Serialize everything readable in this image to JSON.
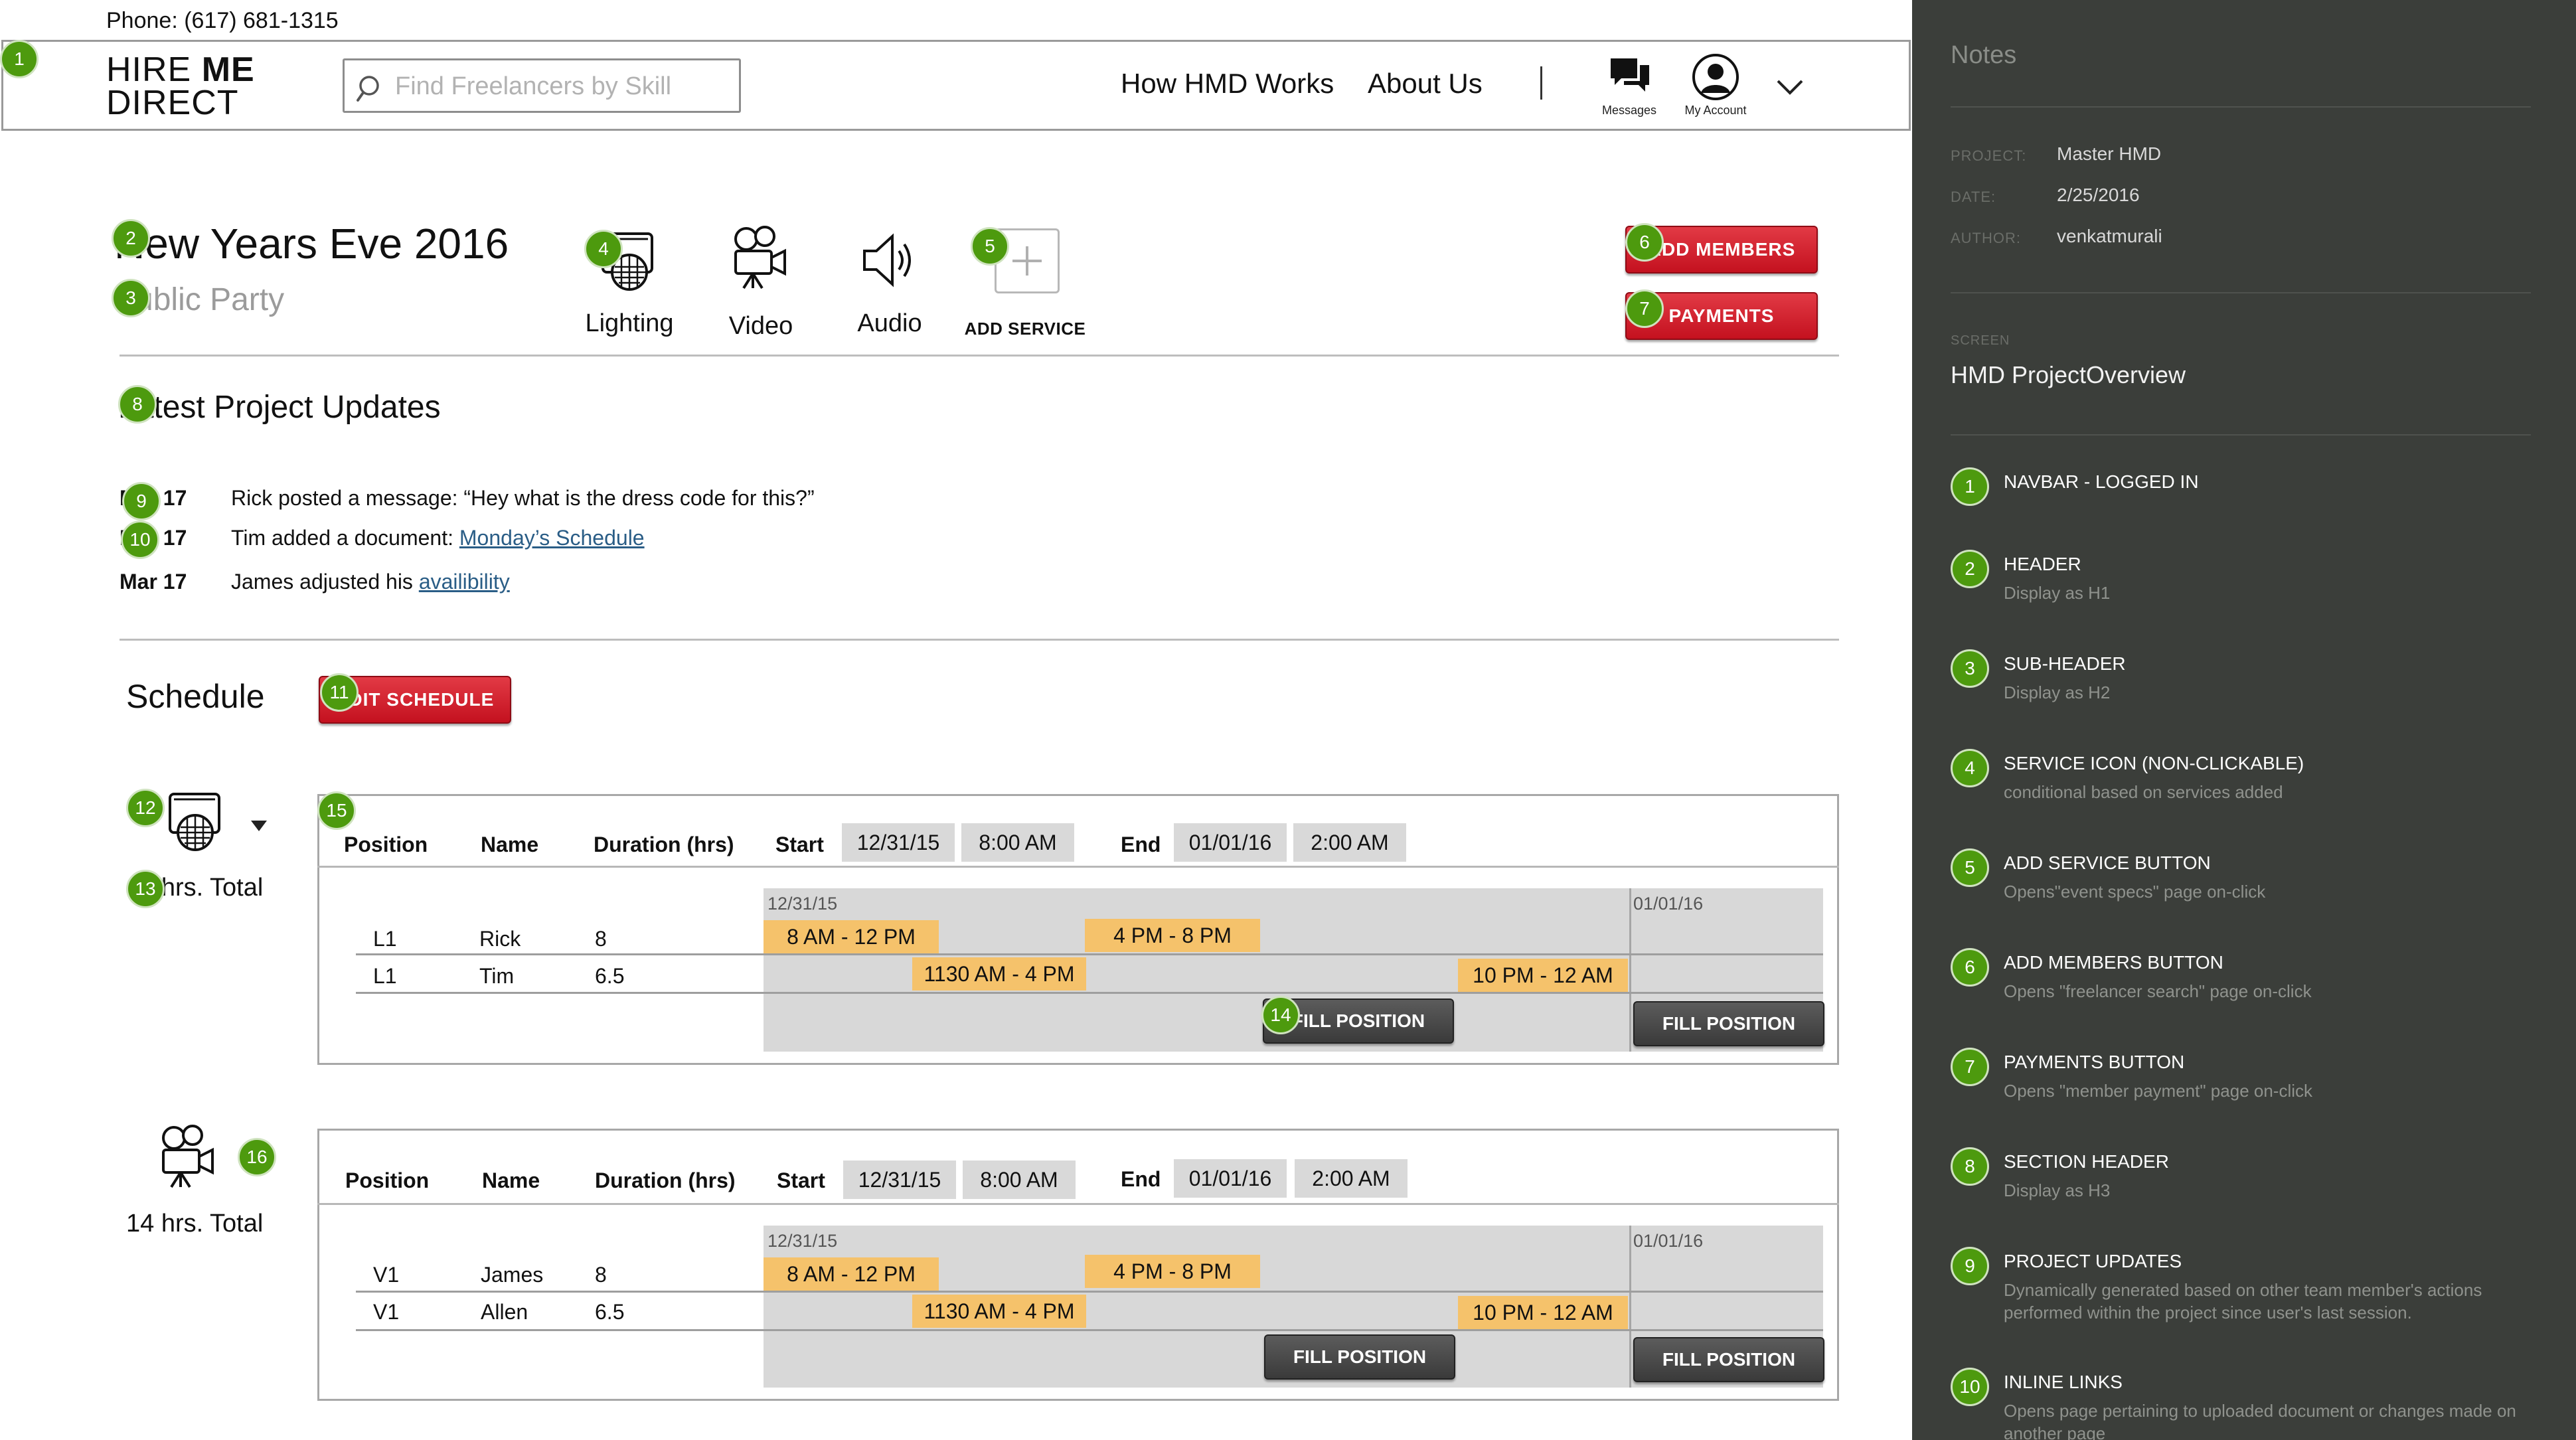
{
  "topbar": {
    "phone": "Phone: (617) 681-1315"
  },
  "navbar": {
    "logo_line1_a": "HIRE ",
    "logo_line1_b": "ME",
    "logo_line2": "DIRECT",
    "search_placeholder": "Find Freelancers by Skill",
    "links": [
      "How HMD Works",
      "About Us"
    ],
    "separator": "|",
    "messages_label": "Messages",
    "account_label": "My Account"
  },
  "header": {
    "title": "New Years Eve 2016",
    "subtitle": "Public Party",
    "services": [
      "Lighting",
      "Video",
      "Audio"
    ],
    "add_service_label": "ADD SERVICE",
    "add_members_label": "ADD MEMBERS",
    "payments_label": "PAYMENTS"
  },
  "updates": {
    "title": "Latest Project Updates",
    "items": [
      {
        "date": "Mar 17",
        "text": "Rick posted a message: “Hey what is the dress code for this?”",
        "link": ""
      },
      {
        "date": "Mar 17",
        "text": "Tim added a document: ",
        "link": "Monday’s Schedule"
      },
      {
        "date": "Mar 17",
        "text": "James adjusted his ",
        "link": "availibility"
      }
    ]
  },
  "schedule": {
    "title": "Schedule",
    "edit_label": "EDIT SCHEDULE",
    "columns": [
      "Position",
      "Name",
      "Duration (hrs)"
    ],
    "start_label": "Start",
    "end_label": "End",
    "fill_label": "FILL POSITION",
    "blocks": [
      {
        "total": "14 hrs. Total",
        "icon": "lighting-icon",
        "start_date": "12/31/15",
        "start_time": "8:00 AM",
        "end_date": "01/01/16",
        "end_time": "2:00 AM",
        "tl_start": "12/31/15",
        "tl_end": "01/01/16",
        "rows": [
          {
            "position": "L1",
            "name": "Rick",
            "duration": "8",
            "slots": [
              "8 AM - 12 PM",
              "4 PM - 8 PM"
            ]
          },
          {
            "position": "L1",
            "name": "Tim",
            "duration": "6.5",
            "slots": [
              "1130 AM - 4 PM",
              "10 PM - 12 AM"
            ]
          }
        ]
      },
      {
        "total": "14 hrs. Total",
        "icon": "video-camera-icon",
        "start_date": "12/31/15",
        "start_time": "8:00 AM",
        "end_date": "01/01/16",
        "end_time": "2:00 AM",
        "tl_start": "12/31/15",
        "tl_end": "01/01/16",
        "rows": [
          {
            "position": "V1",
            "name": "James",
            "duration": "8",
            "slots": [
              "8 AM - 12 PM",
              "4 PM - 8 PM"
            ]
          },
          {
            "position": "V1",
            "name": "Allen",
            "duration": "6.5",
            "slots": [
              "1130 AM - 4 PM",
              "10 PM - 12 AM"
            ]
          }
        ]
      }
    ]
  },
  "badges": [
    "1",
    "2",
    "3",
    "4",
    "5",
    "6",
    "7",
    "8",
    "9",
    "10",
    "11",
    "12",
    "13",
    "14",
    "15",
    "16"
  ],
  "notes": {
    "title": "Notes",
    "meta": [
      {
        "k": "PROJECT:",
        "v": "Master HMD"
      },
      {
        "k": "DATE:",
        "v": "2/25/2016"
      },
      {
        "k": "AUTHOR:",
        "v": "venkatmurali"
      }
    ],
    "screen_label": "SCREEN",
    "screen_name": "HMD ProjectOverview",
    "items": [
      {
        "n": "1",
        "title": "NAVBAR - LOGGED IN",
        "desc": ""
      },
      {
        "n": "2",
        "title": "HEADER",
        "desc": "Display as H1"
      },
      {
        "n": "3",
        "title": "SUB-HEADER",
        "desc": "Display as H2"
      },
      {
        "n": "4",
        "title": "SERVICE ICON (NON-CLICKABLE)",
        "desc": "conditional  based on services added"
      },
      {
        "n": "5",
        "title": "ADD SERVICE BUTTON",
        "desc": "Opens\"event specs\" page on-click"
      },
      {
        "n": "6",
        "title": "ADD MEMBERS BUTTON",
        "desc": "Opens \"freelancer search\" page on-click"
      },
      {
        "n": "7",
        "title": "PAYMENTS BUTTON",
        "desc": "Opens \"member payment\" page on-click"
      },
      {
        "n": "8",
        "title": "SECTION HEADER",
        "desc": "Display as H3"
      },
      {
        "n": "9",
        "title": "PROJECT UPDATES",
        "desc": "Dynamically generated based on other team member's actions performed within the project since user's last session."
      },
      {
        "n": "10",
        "title": "INLINE LINKS",
        "desc": "Opens page pertaining to uploaded document or changes made on another page"
      }
    ]
  },
  "colors": {
    "accent_red": "#c4111f",
    "badge_green": "#4d9a0e",
    "slot_orange": "#f5c26b",
    "notes_bg": "#3b3e3a"
  }
}
